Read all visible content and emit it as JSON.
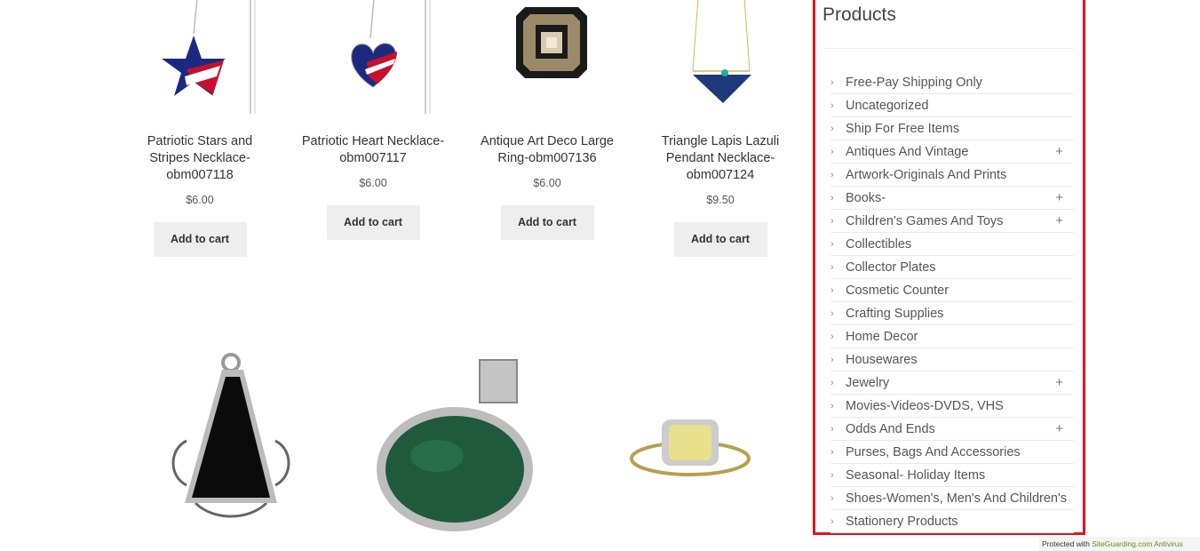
{
  "products": [
    {
      "title": "Patriotic Stars and Stripes Necklace-obm007118",
      "price": "$6.00",
      "cta": "Add to cart"
    },
    {
      "title": "Patriotic Heart Necklace-obm007117",
      "price": "$6.00",
      "cta": "Add to cart"
    },
    {
      "title": "Antique Art Deco Large Ring-obm007136",
      "price": "$6.00",
      "cta": "Add to cart"
    },
    {
      "title": "Triangle Lapis Lazuli Pendant Necklace-obm007124",
      "price": "$9.50",
      "cta": "Add to cart"
    }
  ],
  "sidebar": {
    "title": "Products",
    "arrow_glyph": "›",
    "plus_glyph": "+",
    "items": [
      {
        "label": "Free-Pay Shipping Only",
        "expandable": false
      },
      {
        "label": "Uncategorized",
        "expandable": false
      },
      {
        "label": "Ship For Free Items",
        "expandable": false
      },
      {
        "label": "Antiques And Vintage",
        "expandable": true
      },
      {
        "label": "Artwork-Originals And Prints",
        "expandable": false
      },
      {
        "label": "Books-",
        "expandable": true
      },
      {
        "label": "Children's Games And Toys",
        "expandable": true
      },
      {
        "label": "Collectibles",
        "expandable": false
      },
      {
        "label": "Collector Plates",
        "expandable": false
      },
      {
        "label": "Cosmetic Counter",
        "expandable": false
      },
      {
        "label": "Crafting Supplies",
        "expandable": false
      },
      {
        "label": "Home Decor",
        "expandable": false
      },
      {
        "label": "Housewares",
        "expandable": false
      },
      {
        "label": "Jewelry",
        "expandable": true
      },
      {
        "label": "Movies-Videos-DVDS, VHS",
        "expandable": false
      },
      {
        "label": "Odds And Ends",
        "expandable": true
      },
      {
        "label": "Purses, Bags And Accessories",
        "expandable": false
      },
      {
        "label": "Seasonal- Holiday Items",
        "expandable": false
      },
      {
        "label": "Shoes-Women's, Men's And Children's",
        "expandable": false
      },
      {
        "label": "Stationery Products",
        "expandable": false
      }
    ]
  },
  "footer": {
    "prefix": "Protected with",
    "link": "SiteGuarding.com Antivirus"
  },
  "colors": {
    "highlight_border": "#e8111c",
    "button_bg": "#eeeeee",
    "footer_link": "#5a8e1b"
  }
}
